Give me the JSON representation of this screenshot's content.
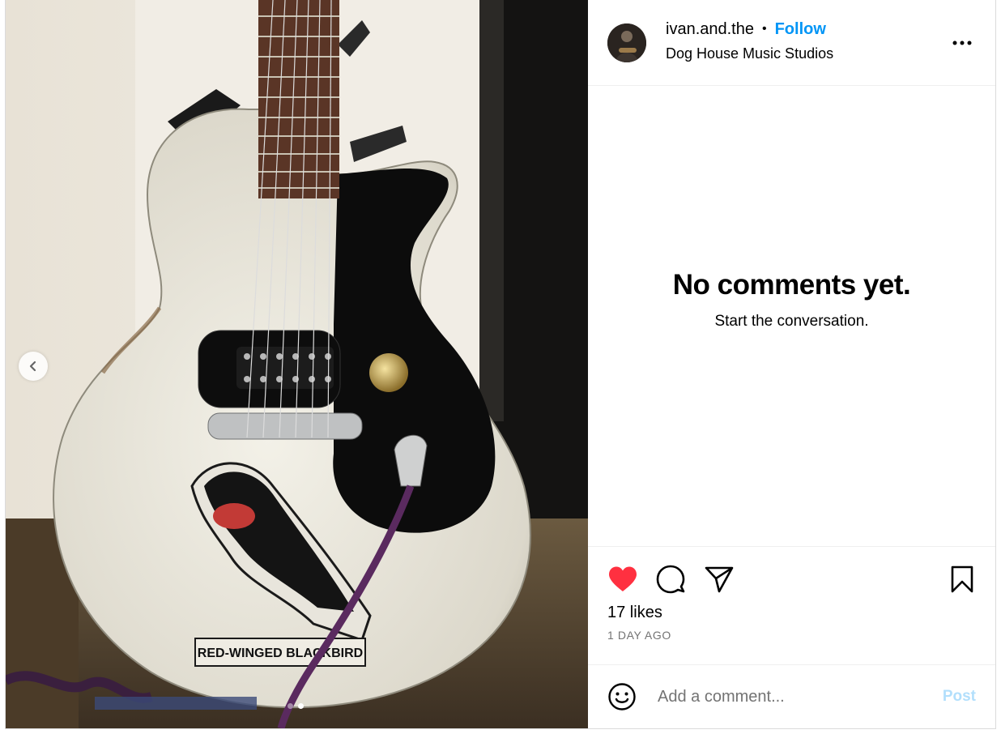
{
  "post": {
    "username": "ivan.and.the",
    "separator": "•",
    "follow_label": "Follow",
    "location": "Dog House Music Studios",
    "more_icon": "more-horizontal-icon"
  },
  "media": {
    "image_description_icon": "photo",
    "sticker_text": "RED-WINGED BLACKBIRD",
    "prev_icon": "chevron-left-icon",
    "carousel_count": 2,
    "carousel_active_index": 1
  },
  "comments": {
    "empty_title": "No comments yet.",
    "empty_subtitle": "Start the conversation."
  },
  "actions": {
    "like_icon": "heart-filled-icon",
    "comment_icon": "comment-icon",
    "share_icon": "share-icon",
    "save_icon": "bookmark-icon",
    "like_color": "#ff3040",
    "likes": "17 likes",
    "timestamp": "1 DAY AGO"
  },
  "composer": {
    "placeholder": "Add a comment...",
    "post_label": "Post",
    "post_color": "#b2dffc",
    "emoji_icon": "emoji-icon"
  },
  "colors": {
    "accent": "#0095f6",
    "secondary_text": "#737373",
    "border": "#dbdbdb"
  }
}
